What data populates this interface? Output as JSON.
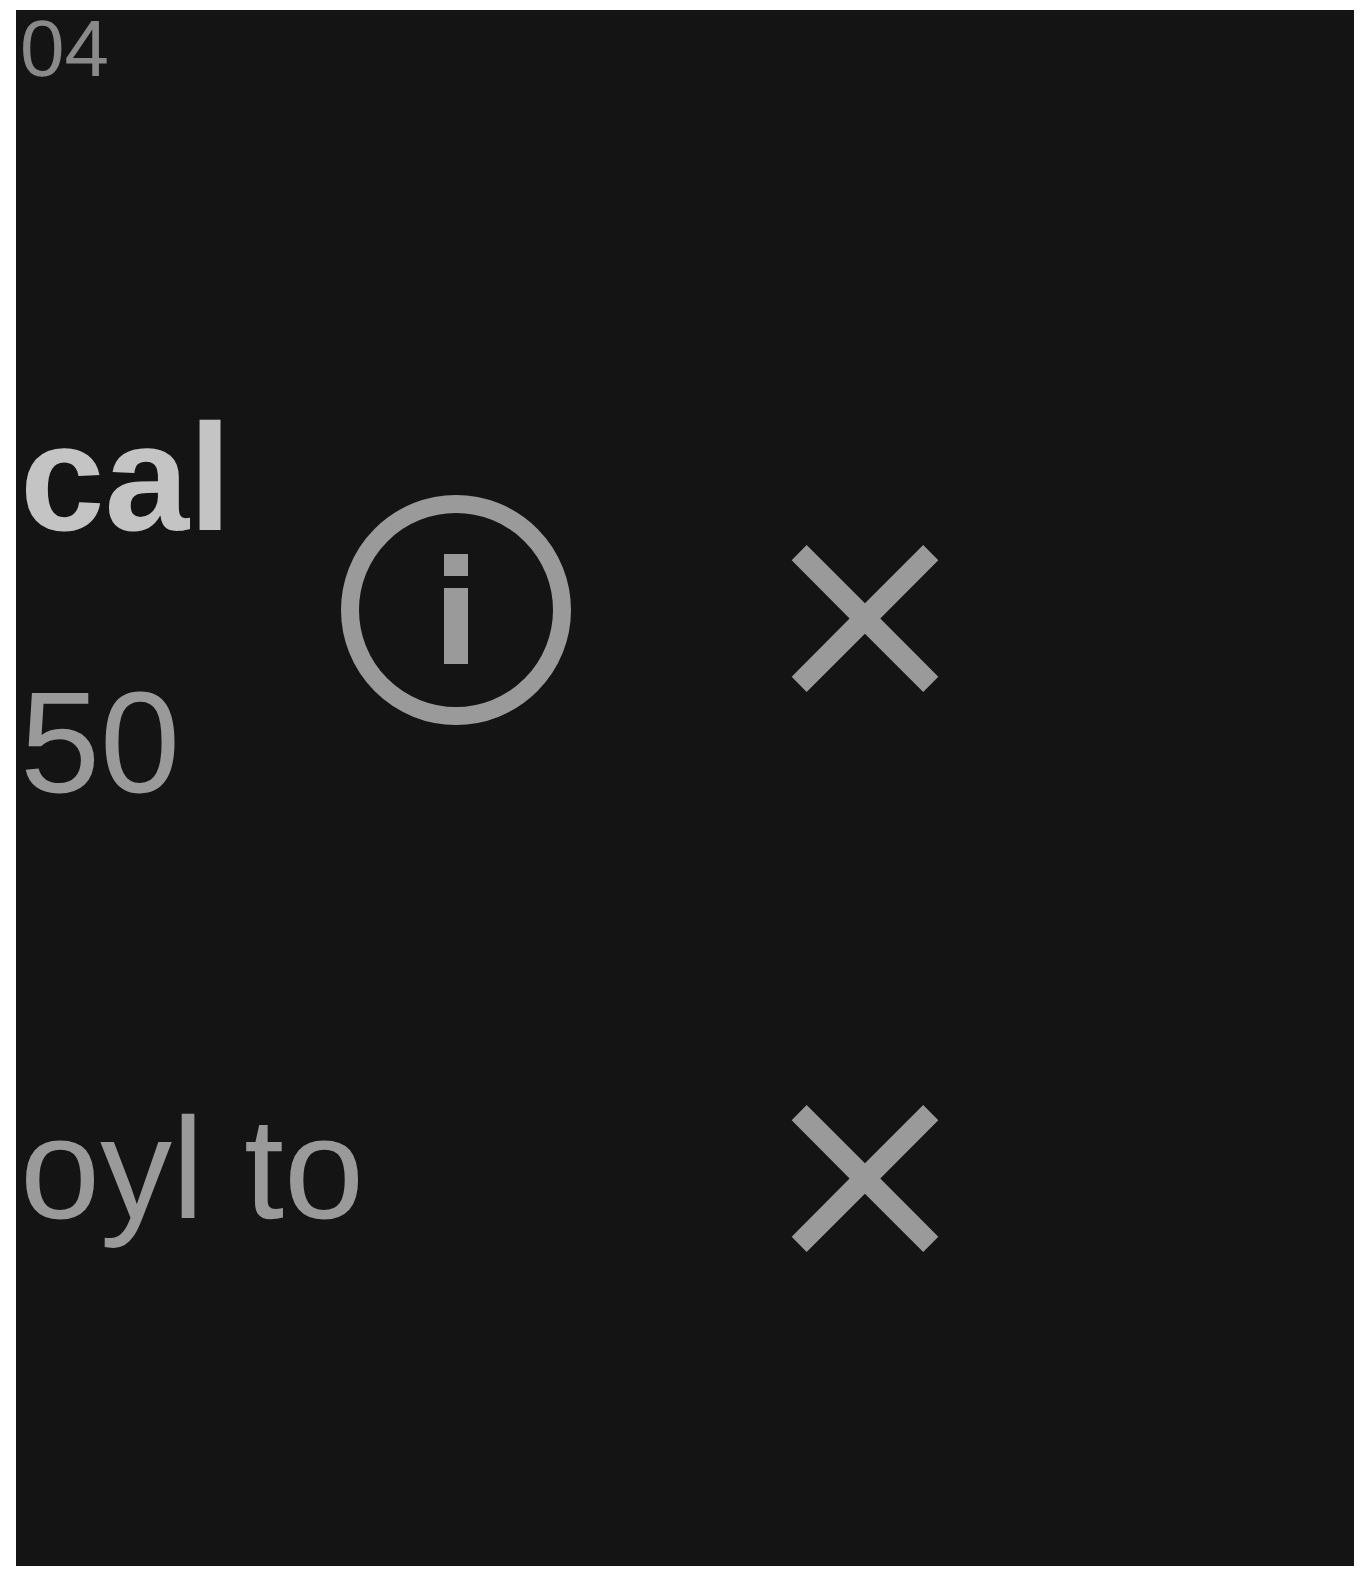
{
  "top_value": "04",
  "items": [
    {
      "kind": "detail",
      "title": "cal",
      "value": "50",
      "dismiss": "×"
    },
    {
      "kind": "note",
      "text": "oyl to",
      "dismiss": "×"
    }
  ]
}
